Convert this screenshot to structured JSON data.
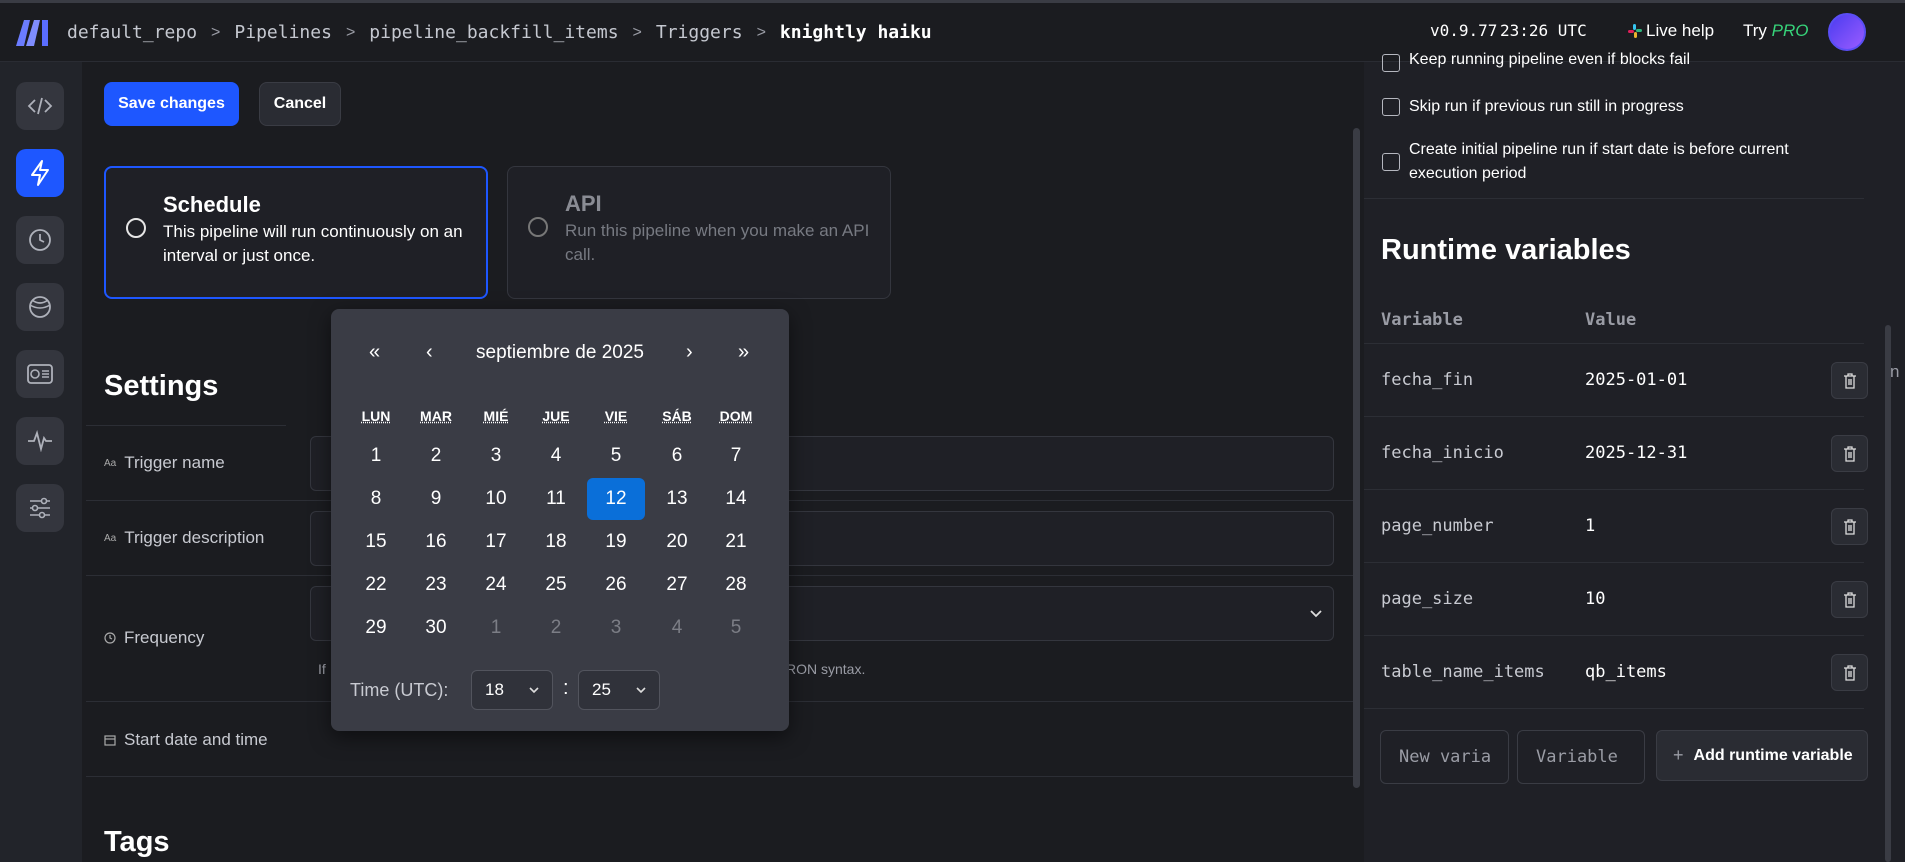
{
  "breadcrumb": {
    "items": [
      "default_repo",
      "Pipelines",
      "pipeline_backfill_items",
      "Triggers"
    ],
    "current": "knightly haiku",
    "separator": ">"
  },
  "header": {
    "version": "v0.9.77",
    "time": "23:26 UTC",
    "live_help": "Live help",
    "try_prefix": "Try",
    "try_pro": "PRO"
  },
  "sidebar": {
    "items": [
      "code-icon",
      "lightning-icon",
      "clock-icon",
      "globe-icon",
      "storage-icon",
      "activity-icon",
      "sliders-icon"
    ],
    "active": "lightning-icon"
  },
  "toolbar": {
    "save_label": "Save changes",
    "cancel_label": "Cancel"
  },
  "trigger_types": [
    {
      "title": "Schedule",
      "description": "This pipeline will run continuously on an interval or just once.",
      "selected": true
    },
    {
      "title": "API",
      "description": "Run this pipeline when you make an API call.",
      "selected": false
    }
  ],
  "settings": {
    "title": "Settings",
    "trigger_name_label": "Trigger name",
    "trigger_description_label": "Trigger description",
    "frequency_label": "Frequency",
    "helper_start": "If",
    "helper_end": "RON syntax.",
    "start_date_label": "Start date and time"
  },
  "tags_title": "Tags",
  "calendar": {
    "month_label": "septiembre de 2025",
    "nav": {
      "prev_year": "«",
      "prev_month": "‹",
      "next_month": "›",
      "next_year": "»"
    },
    "weekdays": [
      "LUN",
      "MAR",
      "MIÉ",
      "JUE",
      "VIE",
      "SÁB",
      "DOM"
    ],
    "weeks": [
      [
        "1",
        "2",
        "3",
        "4",
        "5",
        "6",
        "7"
      ],
      [
        "8",
        "9",
        "10",
        "11",
        "12",
        "13",
        "14"
      ],
      [
        "15",
        "16",
        "17",
        "18",
        "19",
        "20",
        "21"
      ],
      [
        "22",
        "23",
        "24",
        "25",
        "26",
        "27",
        "28"
      ],
      [
        "29",
        "30",
        "1",
        "2",
        "3",
        "4",
        "5"
      ]
    ],
    "selected_day": "12",
    "time_label": "Time (UTC):",
    "hour": "18",
    "minute": "25"
  },
  "options": {
    "keep_running": "Keep running pipeline even if blocks fail",
    "skip_run": "Skip run if previous run still in progress",
    "create_initial": "Create initial pipeline run if start date is before current execution period"
  },
  "runtime": {
    "title": "Runtime variables",
    "col_variable": "Variable",
    "col_value": "Value",
    "rows": [
      {
        "name": "fecha_fin",
        "value": "2025-01-01"
      },
      {
        "name": "fecha_inicio",
        "value": "2025-12-31"
      },
      {
        "name": "page_number",
        "value": "1"
      },
      {
        "name": "page_size",
        "value": "10"
      },
      {
        "name": "table_name_items",
        "value": "qb_items"
      }
    ],
    "new_name_placeholder": "New varia",
    "new_value_placeholder": "Variable",
    "add_label": "Add runtime variable"
  },
  "edge_text": "n",
  "colors": {
    "accent": "#1e57ff",
    "selected_day": "#0a6fd9",
    "pro": "#37d47a"
  }
}
